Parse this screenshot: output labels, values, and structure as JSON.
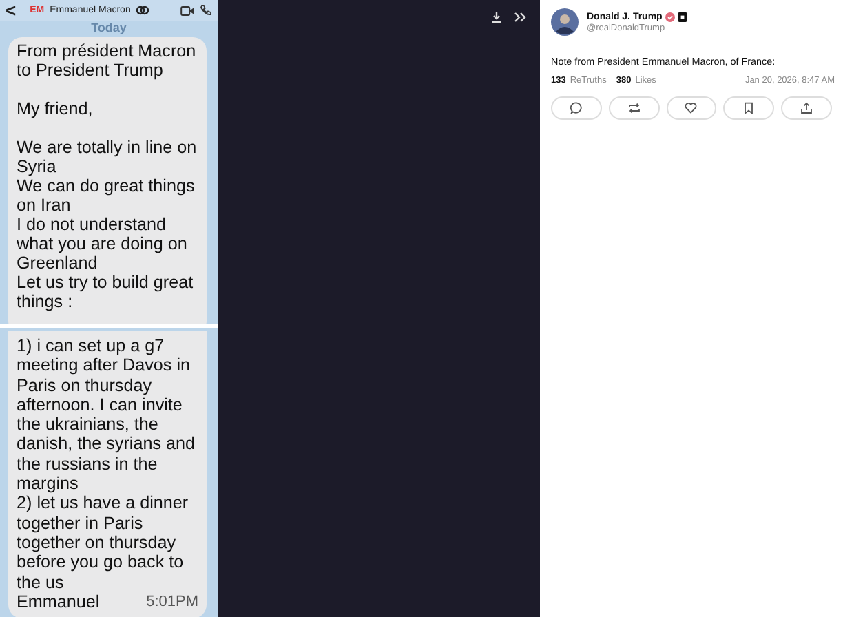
{
  "chat": {
    "back": "<",
    "initials": "EM",
    "contact": "Emmanuel Macron",
    "day": "Today",
    "top_paragraphs": [
      [
        "From président Macron",
        "to President Trump"
      ],
      [
        "My friend,"
      ],
      [
        "We are totally in line on",
        "Syria",
        "We can do great things",
        "on Iran",
        "I do not understand",
        "what you are doing on",
        "Greenland",
        "Let us try to build great",
        "things :"
      ]
    ],
    "bottom_paragraphs": [
      [
        "1) i can set up a g7",
        "meeting after Davos in",
        "Paris on thursday",
        "afternoon. I can invite",
        "the ukrainians, the",
        "danish, the syrians and",
        "the russians in the",
        "margins",
        "2) let us have a dinner",
        "together in Paris",
        "together on thursday",
        "before you go back to",
        "the us"
      ],
      [
        "Emmanuel"
      ]
    ],
    "time": "5:01PM"
  },
  "post": {
    "author": "Donald J. Trump",
    "handle": "@realDonaldTrump",
    "text": "Note from President Emmanuel Macron, of France:",
    "retruths_count": "133",
    "retruths_label": "ReTruths",
    "likes_count": "380",
    "likes_label": "Likes",
    "date": "Jan 20, 2026, 8:47 AM",
    "actions": [
      {
        "kind": "reply"
      },
      {
        "kind": "retruth"
      },
      {
        "kind": "like"
      },
      {
        "kind": "save"
      },
      {
        "kind": "share"
      }
    ]
  }
}
